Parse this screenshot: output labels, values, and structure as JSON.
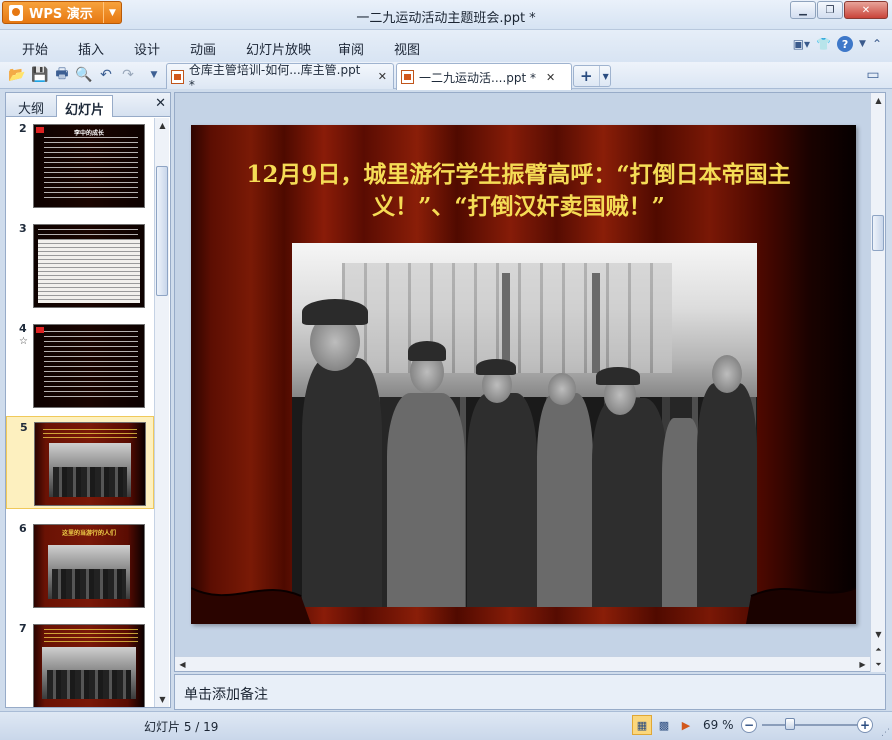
{
  "app": {
    "name": "WPS 演示",
    "title": "一二九运动活动主题班会.ppt *"
  },
  "menu": [
    "开始",
    "插入",
    "设计",
    "动画",
    "幻灯片放映",
    "审阅",
    "视图"
  ],
  "tabs": [
    {
      "label": "仓库主管培训-如何...库主管.ppt *",
      "active": false
    },
    {
      "label": "一二九运动活....ppt *",
      "active": true
    }
  ],
  "panel": {
    "tabs": [
      "大纲",
      "幻灯片"
    ],
    "active_tab": "幻灯片",
    "slides": [
      {
        "num": "2",
        "title": "李中的成长"
      },
      {
        "num": "3",
        "title": ""
      },
      {
        "num": "4",
        "title": ""
      },
      {
        "num": "5",
        "title": "",
        "selected": true
      },
      {
        "num": "6",
        "title": "这里的当游行的人们"
      },
      {
        "num": "7",
        "title": ""
      }
    ]
  },
  "slide": {
    "title": "12月9日，城里游行学生振臂高呼：“打倒日本帝国主义！”、“打倒汉奸卖国贼！”",
    "title_color": "#f5dc55"
  },
  "notes": {
    "placeholder": "单击添加备注"
  },
  "status": {
    "slide_indicator": "幻灯片 5 / 19",
    "zoom": "69 %"
  },
  "colors": {
    "accent": "#e67812",
    "chrome": "#d6e3f3",
    "selected_thumb": "#fdf0bf"
  }
}
